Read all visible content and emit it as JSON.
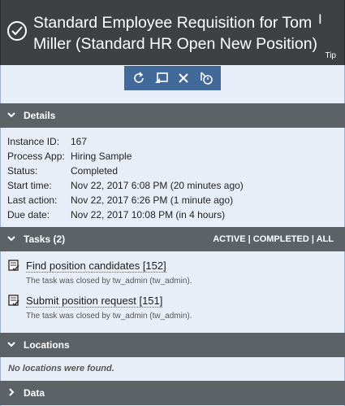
{
  "header": {
    "title": "Standard Employee Requisition for Tom Miller (Standard HR Open New Position)",
    "tip": "Tip"
  },
  "toolbar": {
    "icons": [
      "refresh-icon",
      "reassign-icon",
      "close-icon",
      "timer-icon"
    ]
  },
  "details": {
    "label": "Details",
    "rows": [
      {
        "key": "Instance ID:",
        "value": "167"
      },
      {
        "key": "Process App:",
        "value": "Hiring Sample"
      },
      {
        "key": "Status:",
        "value": "Completed"
      },
      {
        "key": "Start time:",
        "value": "Nov 22, 2017 6:08 PM (20 minutes ago)"
      },
      {
        "key": "Last action:",
        "value": "Nov 22, 2017 6:26 PM (1 minute ago)"
      },
      {
        "key": "Due date:",
        "value": "Nov 22, 2017 10:08 PM (in 4 hours)"
      }
    ]
  },
  "tasks": {
    "label": "Tasks (2)",
    "filter_active": "ACTIVE",
    "filter_sep1": " | ",
    "filter_completed": "COMPLETED",
    "filter_sep2": " | ",
    "filter_all": "ALL",
    "items": [
      {
        "name": "Find position candidates [152]",
        "note": "The task was closed by tw_admin (tw_admin)."
      },
      {
        "name": "Submit position request [151]",
        "note": "The task was closed by tw_admin (tw_admin)."
      }
    ]
  },
  "locations": {
    "label": "Locations",
    "empty": "No locations were found."
  },
  "data_section": {
    "label": "Data"
  }
}
